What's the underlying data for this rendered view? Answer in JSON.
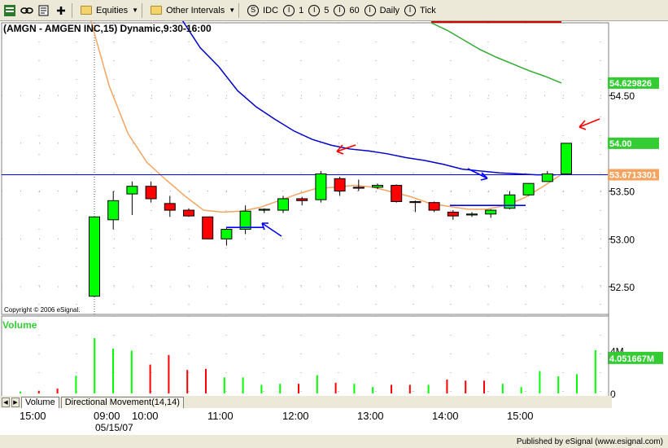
{
  "toolbar": {
    "items": [
      {
        "label": "Equities",
        "icon": "folder-icon",
        "dropdown": true
      },
      {
        "label": "Other Intervals",
        "icon": "folder-icon",
        "dropdown": true
      }
    ],
    "intervals": [
      {
        "symbol": "S",
        "label": "IDC"
      },
      {
        "symbol": "I",
        "label": "1"
      },
      {
        "symbol": "I",
        "label": "5"
      },
      {
        "symbol": "I",
        "label": "60"
      },
      {
        "symbol": "I",
        "label": "Daily"
      },
      {
        "symbol": "I",
        "label": "Tick"
      }
    ]
  },
  "chart_title": "(AMGN - AMGEN INC,15) Dynamic,9:30-16:00",
  "copyright": "Copyright © 2006 eSignal.",
  "publisher": "Published by eSignal (www.esignal.com)",
  "volume_label": "Volume",
  "tabs": [
    "Volume",
    "Directional Movement(14,14)"
  ],
  "date_label": "05/15/07",
  "colors": {
    "up": "#00ff00",
    "down": "#ff0000",
    "ema_fast": "#f4a460",
    "ma_blue": "#0000cc",
    "ma_green": "#33aa33",
    "hline": "#0000ff",
    "volume_label": "#33cc33"
  },
  "chart_data": {
    "type": "candlestick",
    "title": "(AMGN - AMGEN INC,15) Dynamic,9:30-16:00",
    "price_axis": {
      "ylim": [
        52.21,
        55.26
      ],
      "ticks": [
        "52.50",
        "53.00",
        "53.50",
        "54.00",
        "54.50"
      ],
      "markers": [
        {
          "label": "54.629826",
          "value": 54.63,
          "color": "#33cc33"
        },
        {
          "label": "54.00",
          "value": 54.0,
          "color": "#33cc33"
        },
        {
          "label": "53.6713301",
          "value": 53.671,
          "color": "#f4a460"
        }
      ]
    },
    "time_axis": {
      "ticks": [
        "15:00",
        "09:00",
        "10:00",
        "11:00",
        "12:00",
        "13:00",
        "14:00",
        "15:00"
      ]
    },
    "candles": [
      {
        "time": "09:30",
        "open": 52.4,
        "high": 53.23,
        "low": 52.4,
        "close": 53.23
      },
      {
        "time": "09:45",
        "open": 53.2,
        "high": 53.5,
        "low": 53.1,
        "close": 53.4
      },
      {
        "time": "10:00",
        "open": 53.47,
        "high": 53.6,
        "low": 53.25,
        "close": 53.55
      },
      {
        "time": "10:15",
        "open": 53.55,
        "high": 53.6,
        "low": 53.38,
        "close": 53.42
      },
      {
        "time": "10:30",
        "open": 53.37,
        "high": 53.45,
        "low": 53.23,
        "close": 53.3
      },
      {
        "time": "10:45",
        "open": 53.3,
        "high": 53.32,
        "low": 53.23,
        "close": 53.24
      },
      {
        "time": "11:00",
        "open": 53.23,
        "high": 53.23,
        "low": 53.0,
        "close": 53.0
      },
      {
        "time": "11:15",
        "open": 53.0,
        "high": 53.12,
        "low": 52.93,
        "close": 53.1
      },
      {
        "time": "11:30",
        "open": 53.1,
        "high": 53.35,
        "low": 53.05,
        "close": 53.29
      },
      {
        "time": "11:45",
        "open": 53.3,
        "high": 53.32,
        "low": 53.27,
        "close": 53.31
      },
      {
        "time": "12:00",
        "open": 53.3,
        "high": 53.45,
        "low": 53.27,
        "close": 53.42
      },
      {
        "time": "12:15",
        "open": 53.42,
        "high": 53.44,
        "low": 53.35,
        "close": 53.4
      },
      {
        "time": "12:30",
        "open": 53.41,
        "high": 53.71,
        "low": 53.38,
        "close": 53.68
      },
      {
        "time": "12:45",
        "open": 53.63,
        "high": 53.65,
        "low": 53.45,
        "close": 53.5
      },
      {
        "time": "13:00",
        "open": 53.54,
        "high": 53.62,
        "low": 53.5,
        "close": 53.53
      },
      {
        "time": "13:15",
        "open": 53.54,
        "high": 53.58,
        "low": 53.52,
        "close": 53.56
      },
      {
        "time": "13:30",
        "open": 53.56,
        "high": 53.57,
        "low": 53.38,
        "close": 53.39
      },
      {
        "time": "13:45",
        "open": 53.39,
        "high": 53.4,
        "low": 53.28,
        "close": 53.38
      },
      {
        "time": "14:00",
        "open": 53.38,
        "high": 53.39,
        "low": 53.28,
        "close": 53.3
      },
      {
        "time": "14:15",
        "open": 53.28,
        "high": 53.3,
        "low": 53.2,
        "close": 53.24
      },
      {
        "time": "14:30",
        "open": 53.25,
        "high": 53.28,
        "low": 53.23,
        "close": 53.26
      },
      {
        "time": "14:45",
        "open": 53.26,
        "high": 53.31,
        "low": 53.22,
        "close": 53.3
      },
      {
        "time": "15:00",
        "open": 53.32,
        "high": 53.5,
        "low": 53.31,
        "close": 53.46
      },
      {
        "time": "15:15",
        "open": 53.46,
        "high": 53.58,
        "low": 53.45,
        "close": 53.58
      },
      {
        "time": "15:30",
        "open": 53.6,
        "high": 53.71,
        "low": 53.6,
        "close": 53.68
      },
      {
        "time": "15:45",
        "open": 53.68,
        "high": 54.0,
        "low": 53.68,
        "close": 54.0
      }
    ],
    "volume": {
      "ticks": [
        "4M",
        "0"
      ],
      "ylim": [
        0,
        4500000
      ],
      "last_label": "4.051667M",
      "bars": [
        {
          "value": 180000,
          "color": "#00ff00"
        },
        {
          "value": 250000,
          "color": "#ff0000"
        },
        {
          "value": 450000,
          "color": "#ff0000"
        },
        {
          "value": 1650000,
          "color": "#00ff00"
        },
        {
          "value": 7500000,
          "color": "#00ff00"
        },
        {
          "value": 4200000,
          "color": "#00ff00"
        },
        {
          "value": 4000000,
          "color": "#00ff00"
        },
        {
          "value": 2700000,
          "color": "#ff0000"
        },
        {
          "value": 3600000,
          "color": "#ff0000"
        },
        {
          "value": 2200000,
          "color": "#ff0000"
        },
        {
          "value": 2300000,
          "color": "#ff0000"
        },
        {
          "value": 1500000,
          "color": "#00ff00"
        },
        {
          "value": 1500000,
          "color": "#00ff00"
        },
        {
          "value": 800000,
          "color": "#00ff00"
        },
        {
          "value": 900000,
          "color": "#00ff00"
        },
        {
          "value": 900000,
          "color": "#ff0000"
        },
        {
          "value": 1700000,
          "color": "#00ff00"
        },
        {
          "value": 1000000,
          "color": "#ff0000"
        },
        {
          "value": 900000,
          "color": "#00ff00"
        },
        {
          "value": 600000,
          "color": "#00ff00"
        },
        {
          "value": 800000,
          "color": "#ff0000"
        },
        {
          "value": 800000,
          "color": "#ff0000"
        },
        {
          "value": 800000,
          "color": "#00ff00"
        },
        {
          "value": 1300000,
          "color": "#ff0000"
        },
        {
          "value": 1200000,
          "color": "#ff0000"
        },
        {
          "value": 1200000,
          "color": "#ff0000"
        },
        {
          "value": 900000,
          "color": "#00ff00"
        },
        {
          "value": 600000,
          "color": "#00ff00"
        },
        {
          "value": 2100000,
          "color": "#00ff00"
        },
        {
          "value": 1600000,
          "color": "#00ff00"
        },
        {
          "value": 1800000,
          "color": "#00ff00"
        },
        {
          "value": 4050000,
          "color": "#00ff00"
        }
      ]
    },
    "overlays": {
      "ema_orange": [
        55.3,
        54.6,
        54.1,
        53.8,
        53.62,
        53.45,
        53.3,
        53.28,
        53.29,
        53.33,
        53.4,
        53.47,
        53.53,
        53.54,
        53.56,
        53.54,
        53.49,
        53.44,
        53.37,
        53.34,
        53.31,
        53.31,
        53.35,
        53.43,
        53.55,
        53.68
      ],
      "ma_blue": [
        55.5,
        55.3,
        55.0,
        54.8,
        54.55,
        54.38,
        54.25,
        54.13,
        54.04,
        53.98,
        53.94,
        53.92,
        53.89,
        53.85,
        53.82,
        53.78,
        53.73,
        53.71,
        53.69,
        53.68,
        53.67,
        53.67
      ],
      "ma_green": [
        55.26,
        55.18,
        55.08,
        54.98,
        54.9,
        54.83,
        54.76,
        54.7,
        54.63
      ],
      "hline": 53.671
    }
  }
}
